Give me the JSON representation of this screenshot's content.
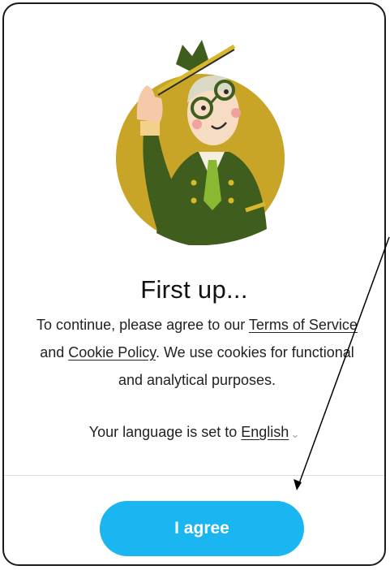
{
  "dialog": {
    "title": "First up...",
    "body_prefix": "To continue, please agree to our ",
    "terms_link": "Terms of Service",
    "body_mid": " and ",
    "cookie_link": "Cookie Policy",
    "body_suffix": ". We use cookies for functional and analytical purposes.",
    "language_prefix": "Your language is set to ",
    "language_value": "English",
    "agree_label": "I agree"
  },
  "icons": {
    "illustration": "character-illustration",
    "language_chevron": "chevron-down-icon",
    "annotation": "arrow-icon"
  },
  "colors": {
    "accent": "#1ab6f2",
    "circle": "#c8a526",
    "coat": "#3f5d1c"
  }
}
